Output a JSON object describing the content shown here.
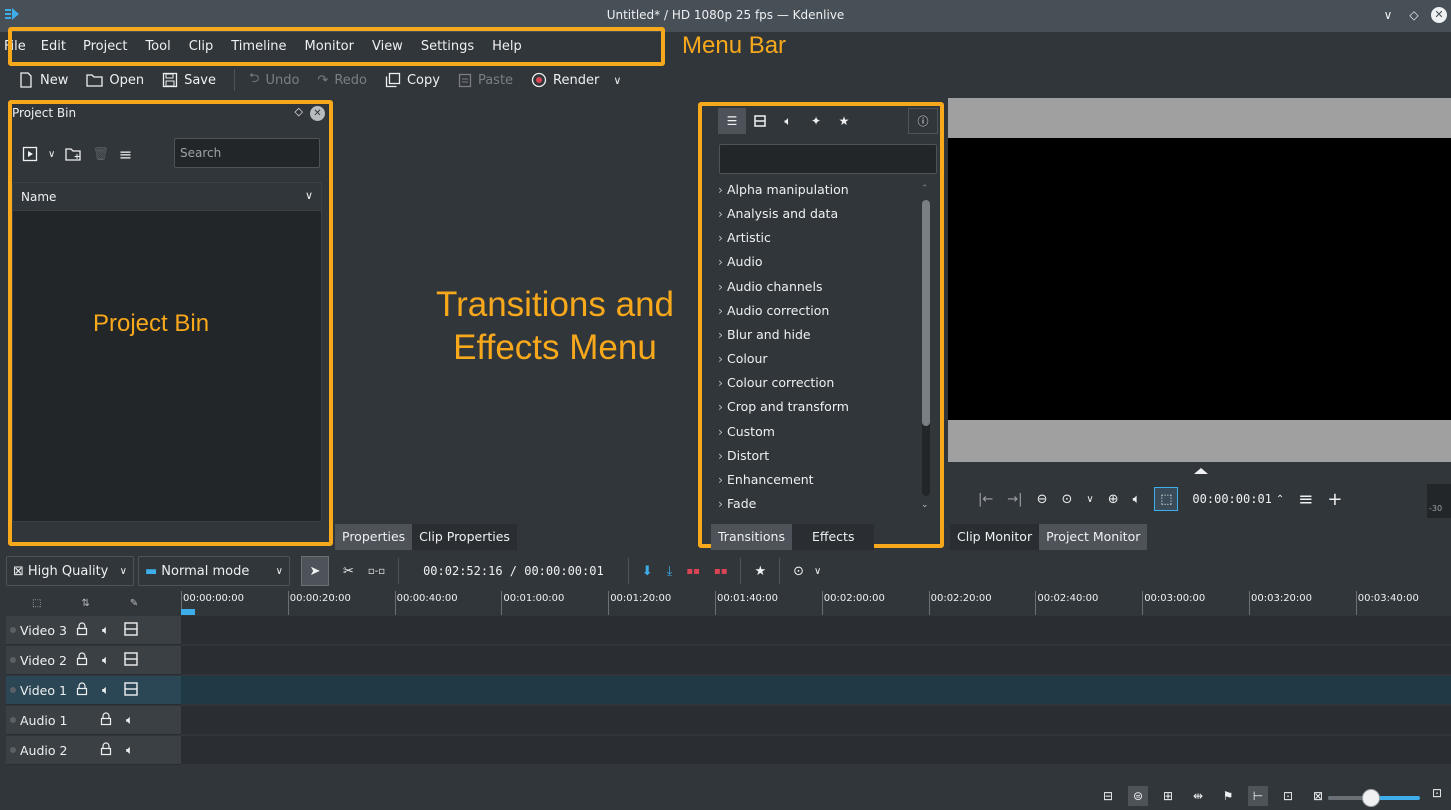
{
  "window": {
    "title": "Untitled* / HD 1080p 25 fps — Kdenlive"
  },
  "menubar": {
    "items": [
      "File",
      "Edit",
      "Project",
      "Tool",
      "Clip",
      "Timeline",
      "Monitor",
      "View",
      "Settings",
      "Help"
    ]
  },
  "toolbar": {
    "new_label": "New",
    "open_label": "Open",
    "save_label": "Save",
    "undo_label": "Undo",
    "redo_label": "Redo",
    "copy_label": "Copy",
    "paste_label": "Paste",
    "render_label": "Render"
  },
  "project_bin": {
    "title": "Project Bin",
    "search_placeholder": "Search",
    "column_name": "Name"
  },
  "effects": {
    "categories": [
      "Alpha manipulation",
      "Analysis and data",
      "Artistic",
      "Audio",
      "Audio channels",
      "Audio correction",
      "Blur and hide",
      "Colour",
      "Colour correction",
      "Crop and transform",
      "Custom",
      "Distort",
      "Enhancement",
      "Fade"
    ]
  },
  "tabs": {
    "properties": "Properties",
    "clip_properties": "Clip Properties",
    "transitions": "Transitions",
    "effects": "Effects",
    "clip_monitor": "Clip Monitor",
    "project_monitor": "Project Monitor"
  },
  "monitor": {
    "timecode": "00:00:00:01",
    "vu_label": "-30"
  },
  "timeline": {
    "quality": "High Quality",
    "mode": "Normal mode",
    "timecode": "00:02:52:16 / 00:00:00:01",
    "ruler": [
      "00:00:00:00",
      "00:00:20:00",
      "00:00:40:00",
      "00:01:00:00",
      "00:01:20:00",
      "00:01:40:00",
      "00:02:00:00",
      "00:02:20:00",
      "00:02:40:00",
      "00:03:00:00",
      "00:03:20:00",
      "00:03:40:00"
    ],
    "tracks": [
      {
        "name": "Video 3",
        "type": "video"
      },
      {
        "name": "Video 2",
        "type": "video"
      },
      {
        "name": "Video 1",
        "type": "video"
      },
      {
        "name": "Audio 1",
        "type": "audio"
      },
      {
        "name": "Audio 2",
        "type": "audio"
      }
    ]
  },
  "annotations": {
    "menu_bar": "Menu Bar",
    "project_bin": "Project Bin",
    "effects_menu": "Transitions and Effects Menu"
  },
  "colors": {
    "annotation": "#f7a81b",
    "accent": "#3daee9",
    "background": "#31363b"
  }
}
